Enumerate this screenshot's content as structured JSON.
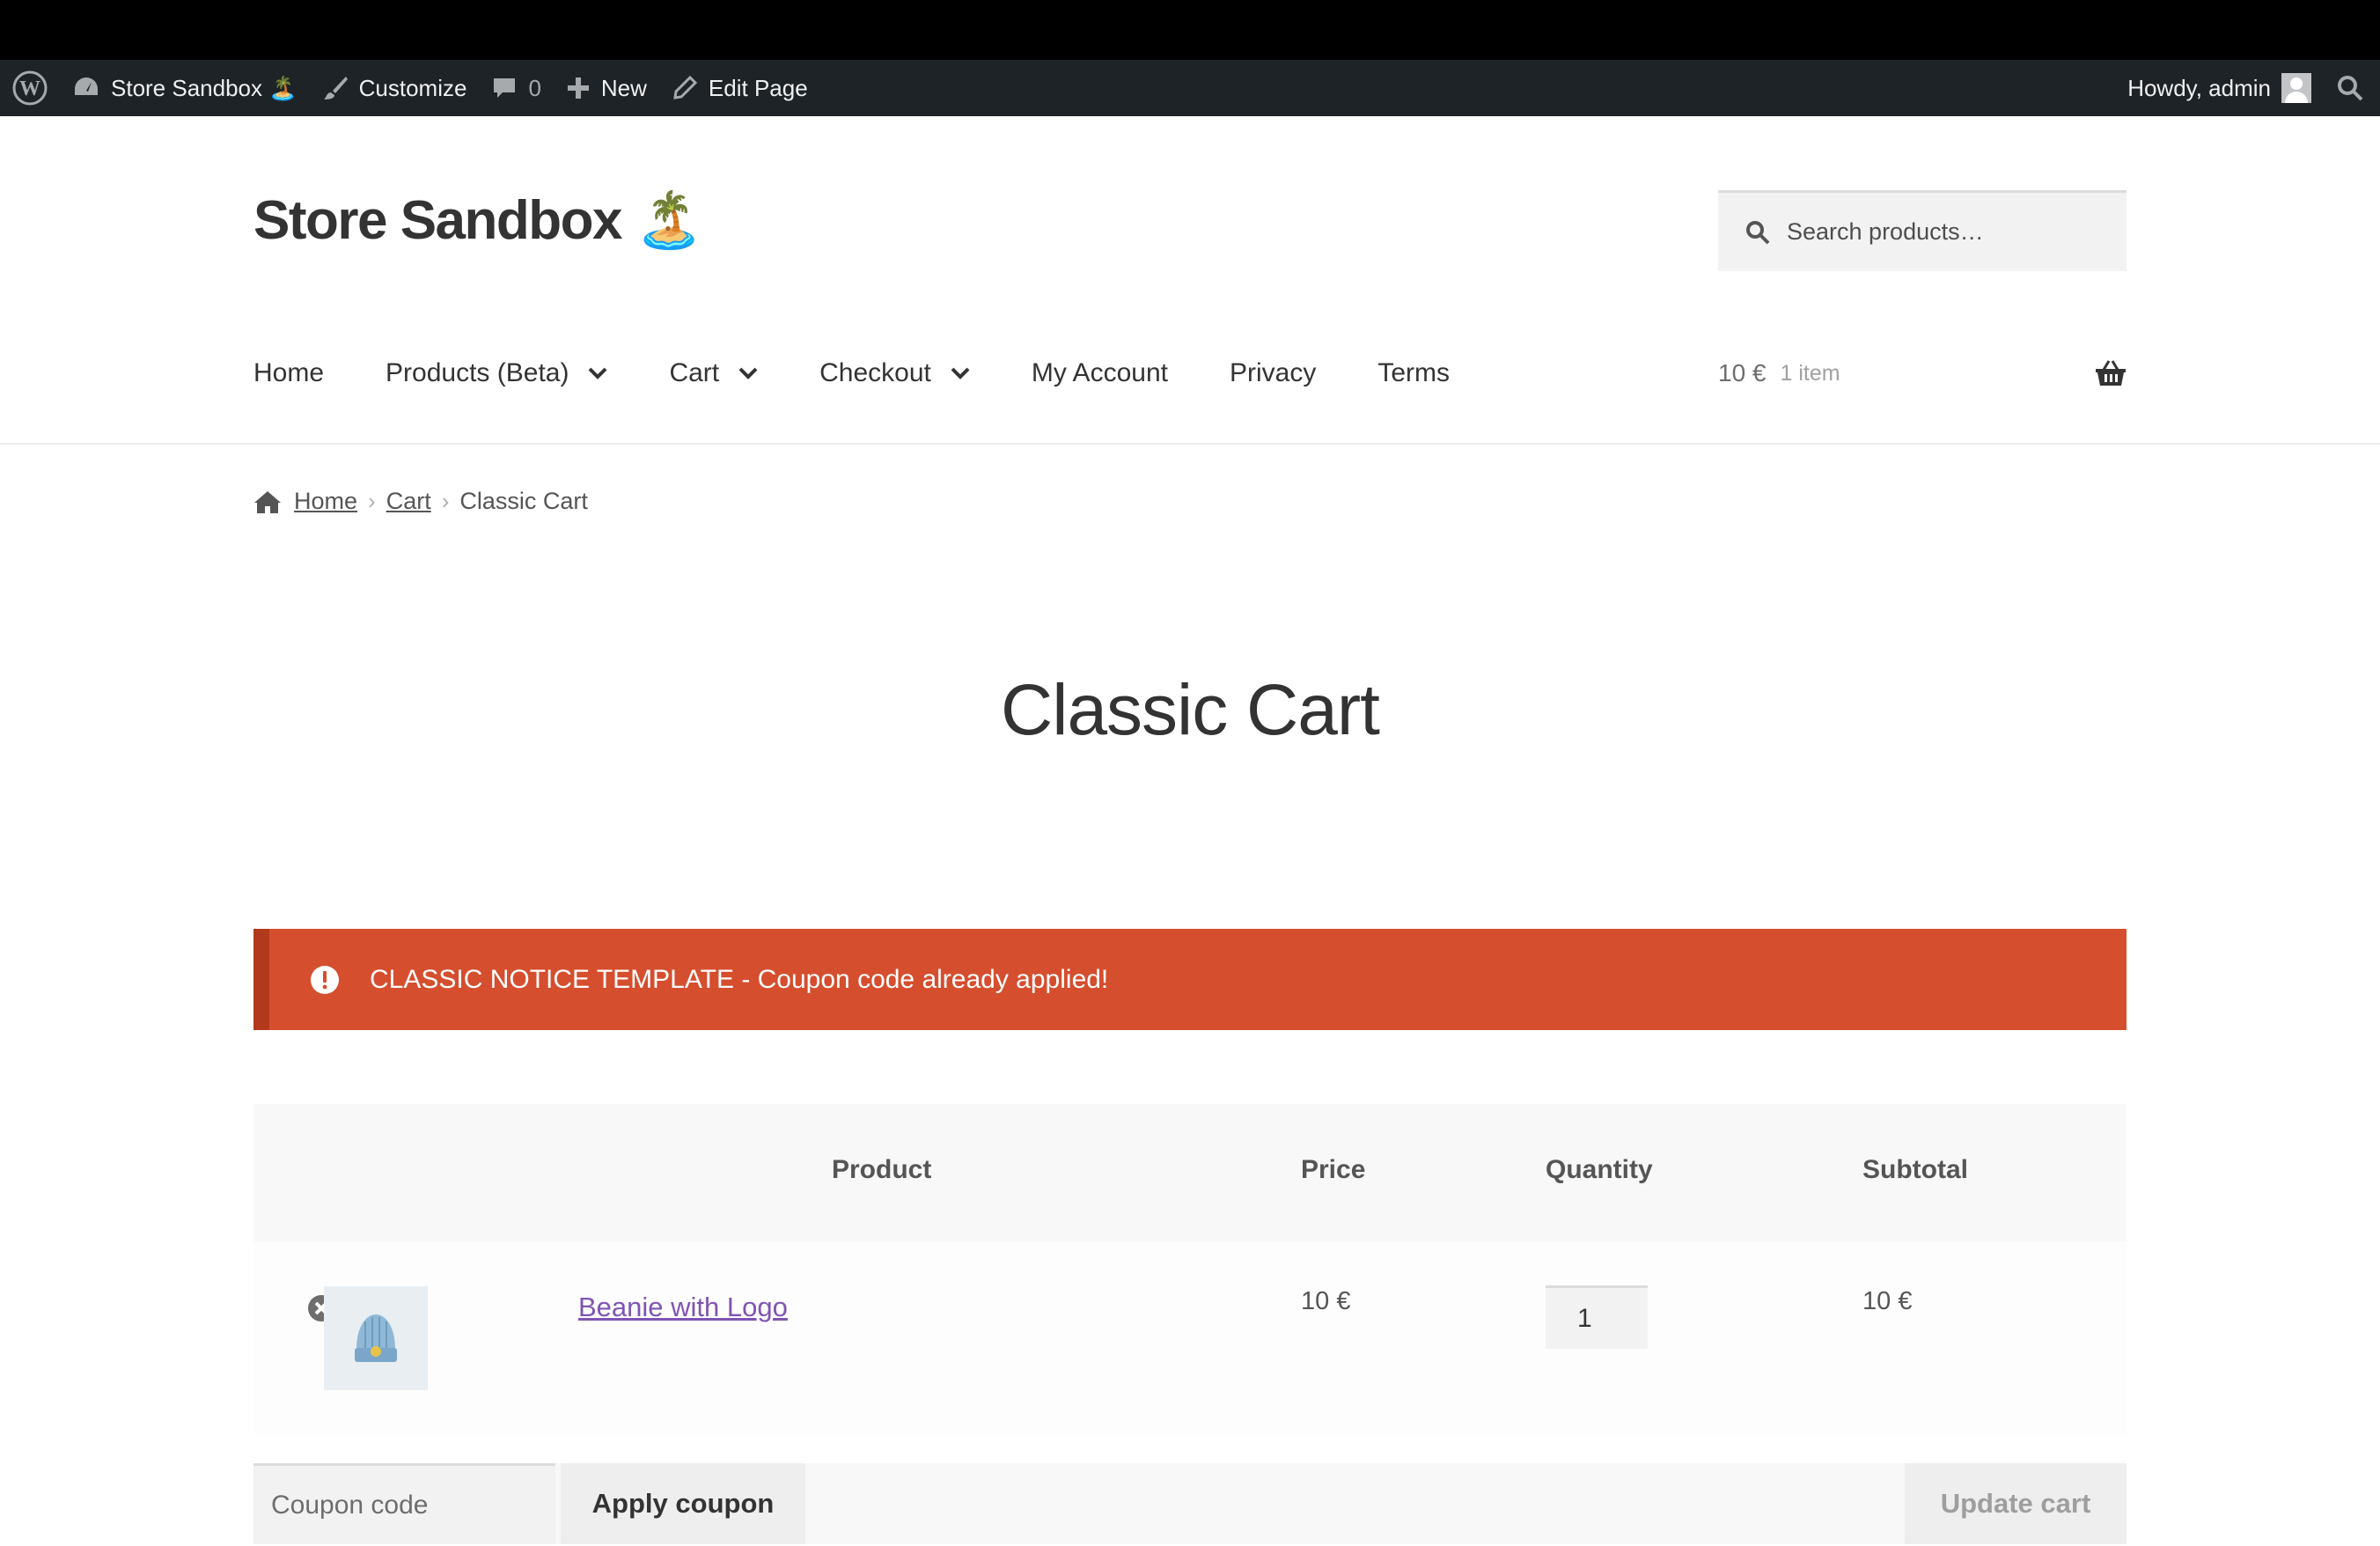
{
  "admin_bar": {
    "site_name": "Store Sandbox 🏝️",
    "customize": "Customize",
    "comments_count": "0",
    "new": "New",
    "edit_page": "Edit Page",
    "greeting": "Howdy, admin"
  },
  "header": {
    "site_title": "Store Sandbox 🏝️",
    "search_placeholder": "Search products…"
  },
  "nav": {
    "items": [
      {
        "label": "Home"
      },
      {
        "label": "Products (Beta)"
      },
      {
        "label": "Cart"
      },
      {
        "label": "Checkout"
      },
      {
        "label": "My Account"
      },
      {
        "label": "Privacy"
      },
      {
        "label": "Terms"
      }
    ]
  },
  "mini_cart": {
    "amount": "10 €",
    "count": "1 item"
  },
  "breadcrumb": {
    "home": "Home",
    "cart": "Cart",
    "current": "Classic Cart"
  },
  "page": {
    "title": "Classic Cart"
  },
  "notice": {
    "text": "CLASSIC NOTICE TEMPLATE - Coupon code already applied!",
    "color": "#d54e2e"
  },
  "cart_table": {
    "headers": {
      "product": "Product",
      "price": "Price",
      "quantity": "Quantity",
      "subtotal": "Subtotal"
    },
    "rows": [
      {
        "product": "Beanie with Logo",
        "price": "10 €",
        "quantity": "1",
        "subtotal": "10 €"
      }
    ]
  },
  "actions": {
    "coupon_placeholder": "Coupon code",
    "apply_coupon": "Apply coupon",
    "update_cart": "Update cart"
  }
}
